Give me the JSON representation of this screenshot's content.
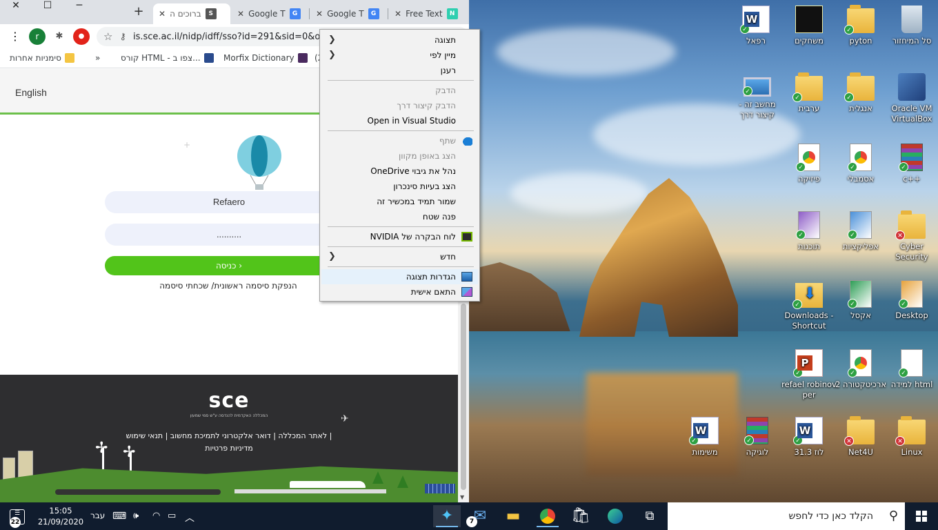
{
  "browser": {
    "tabs": [
      {
        "label": "ברוכים ה",
        "active": true
      },
      {
        "label": "Google T",
        "active": false
      },
      {
        "label": "Google T",
        "active": false
      },
      {
        "label": "Free Text",
        "active": false
      }
    ],
    "new_tab": "+",
    "url": "is.sce.ac.il/nidp/idff/sso?id=291&sid=0&o",
    "profile_initial": "r",
    "bookmarks": [
      {
        "label": "סימניות אחרות"
      },
      {
        "label": "»"
      },
      {
        "label": "קורס HTML - צפו ב..."
      },
      {
        "label": "Morfix Dictionary"
      },
      {
        "label": "(2"
      }
    ]
  },
  "page": {
    "language_link": "English",
    "username_value": "Refaero",
    "password_value": "..........",
    "login_button": "כניסה ›",
    "reset_link": "הנפקת סיסמה ראשונית/ שכחתי סיסמה",
    "footer": {
      "logo": "sce",
      "logo_sub": "המכללה האקדמית להנדסה ע\"ש סמי שמעון",
      "links_line1": "לאתר המכללה | דואר אלקטרוני לתמיכת מחשוב | תנאי שימוש |",
      "links_line2": "מדיניות פרטיות"
    }
  },
  "context_menu": {
    "items": [
      {
        "label": "תצוגה",
        "submenu": true,
        "disabled": false
      },
      {
        "label": "מיין לפי",
        "submenu": true,
        "disabled": false
      },
      {
        "label": "רענן",
        "submenu": false,
        "disabled": false
      },
      {
        "label": "הדבק",
        "submenu": false,
        "disabled": true
      },
      {
        "label": "הדבק קיצור דרך",
        "submenu": false,
        "disabled": true
      },
      {
        "label": "Open in Visual Studio",
        "submenu": false,
        "disabled": false
      },
      {
        "label": "שתף",
        "submenu": false,
        "disabled": true,
        "icon": "onedrive-icon"
      },
      {
        "label": "הצג באופן מקוון",
        "submenu": false,
        "disabled": true
      },
      {
        "label": "נהל את גיבוי OneDrive",
        "submenu": false,
        "disabled": false
      },
      {
        "label": "הצג בעיות סינכרון",
        "submenu": false,
        "disabled": false
      },
      {
        "label": "שמור תמיד במכשיר זה",
        "submenu": false,
        "disabled": false
      },
      {
        "label": "פנה שטח",
        "submenu": false,
        "disabled": false
      },
      {
        "label": "לוח הבקרה של NVIDIA",
        "submenu": false,
        "disabled": false,
        "icon": "nvidia-icon"
      },
      {
        "label": "חדש",
        "submenu": true,
        "disabled": false
      },
      {
        "label": "הגדרות תצוגה",
        "submenu": false,
        "disabled": false,
        "icon": "display-settings-icon",
        "highlighted": true
      },
      {
        "label": "התאם אישית",
        "submenu": false,
        "disabled": false,
        "icon": "personalize-icon"
      }
    ]
  },
  "desktop_icons": [
    {
      "label": "סל המיחזור",
      "icon": "recycle-bin-icon",
      "status": "none"
    },
    {
      "label": "pyton",
      "icon": "folder-icon",
      "status": "ok"
    },
    {
      "label": "משחקים",
      "icon": "folder-icon",
      "status": "none"
    },
    {
      "label": "רפאל",
      "icon": "word-doc-icon",
      "status": "ok"
    },
    {
      "label": "Oracle VM VirtualBox",
      "icon": "virtualbox-icon",
      "status": "none"
    },
    {
      "label": "אנגלית",
      "icon": "folder-icon",
      "status": "ok"
    },
    {
      "label": "ערבית",
      "icon": "folder-icon",
      "status": "ok"
    },
    {
      "label": "מחשב זה - קיצור דרך",
      "icon": "computer-icon",
      "status": "ok"
    },
    {
      "label": "c++",
      "icon": "archive-icon",
      "status": "ok"
    },
    {
      "label": "אסמבלי",
      "icon": "file-icon",
      "status": "ok"
    },
    {
      "label": "פיזיקה",
      "icon": "file-icon",
      "status": "ok"
    },
    {
      "label": "Cyber Security",
      "icon": "folder-icon",
      "status": "error"
    },
    {
      "label": "אפליקציות",
      "icon": "file-icon",
      "status": "ok"
    },
    {
      "label": "תוכנות",
      "icon": "file-icon",
      "status": "ok"
    },
    {
      "label": "Desktop",
      "icon": "file-icon",
      "status": "ok"
    },
    {
      "label": "אקסל",
      "icon": "file-icon",
      "status": "ok"
    },
    {
      "label": "Downloads - Shortcut",
      "icon": "downloads-icon",
      "status": "ok"
    },
    {
      "label": "למידה html",
      "icon": "file-icon",
      "status": "ok"
    },
    {
      "label": "ארכיטקטורה 2",
      "icon": "file-icon",
      "status": "ok"
    },
    {
      "label": "refael robinov per",
      "icon": "powerpoint-icon",
      "status": "ok"
    },
    {
      "label": "Linux",
      "icon": "folder-icon",
      "status": "error"
    },
    {
      "label": "Net4U",
      "icon": "folder-icon",
      "status": "error"
    },
    {
      "label": "לוז 31.3",
      "icon": "word-doc-icon",
      "status": "ok"
    },
    {
      "label": "לוגיקה",
      "icon": "archive-icon",
      "status": "ok"
    },
    {
      "label": "משימות",
      "icon": "word-doc-icon",
      "status": "ok"
    }
  ],
  "taskbar": {
    "search_placeholder": "הקלד כאן כדי לחפש",
    "time": "15:05",
    "date": "21/09/2020",
    "language": "עבר",
    "notifications_count": "22",
    "mail_badge": "7"
  },
  "colors": {
    "accent_green": "#52c41a",
    "taskbar_bg": "#101c2e",
    "menu_highlight": "#e5f1fb"
  }
}
